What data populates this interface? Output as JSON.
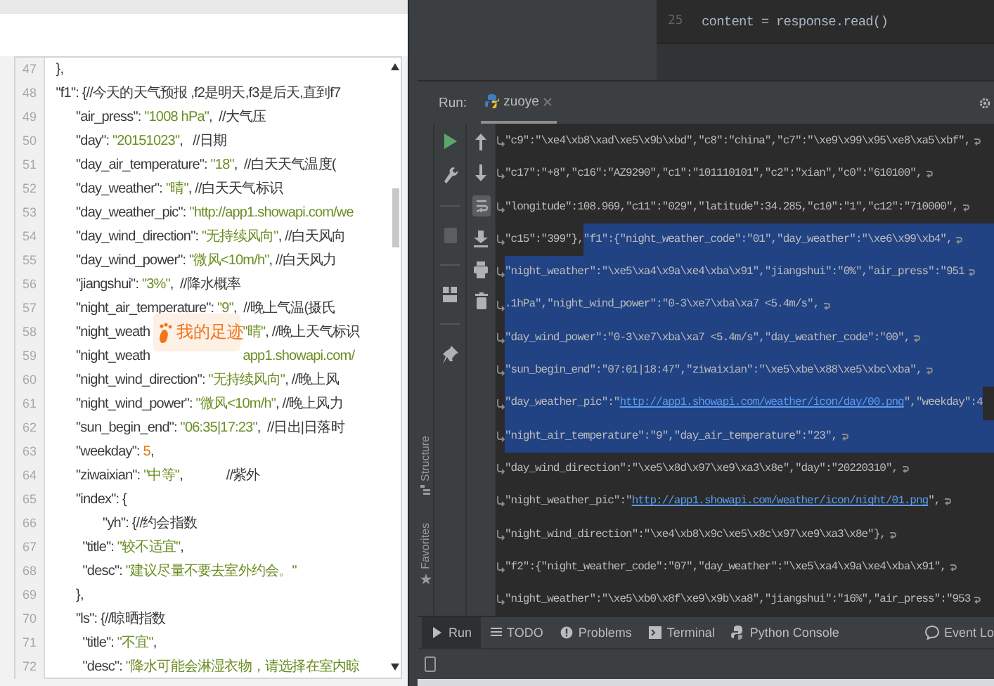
{
  "code_view": {
    "overlay_badge": {
      "label": "我的足迹"
    },
    "lines": [
      {
        "number": "47",
        "segments": [
          {
            "kind": "code",
            "t": "  },"
          }
        ]
      },
      {
        "number": "48",
        "segments": [
          {
            "kind": "code",
            "t": "  \"f1\": {//今天的天气预报 ,f2是明天,f3是后天,直到f7"
          }
        ]
      },
      {
        "number": "49",
        "segments": [
          {
            "kind": "code",
            "t": "        \"air_press\": "
          },
          {
            "kind": "str",
            "t": "\"1008 hPa\""
          },
          {
            "kind": "code",
            "t": ",  //大气压"
          }
        ]
      },
      {
        "number": "50",
        "segments": [
          {
            "kind": "code",
            "t": "        \"day\": "
          },
          {
            "kind": "str",
            "t": "\"20151023\""
          },
          {
            "kind": "code",
            "t": ",   //日期"
          }
        ]
      },
      {
        "number": "51",
        "segments": [
          {
            "kind": "code",
            "t": "        \"day_air_temperature\": "
          },
          {
            "kind": "str",
            "t": "\"18\""
          },
          {
            "kind": "code",
            "t": ",  //白天天气温度("
          }
        ]
      },
      {
        "number": "52",
        "segments": [
          {
            "kind": "code",
            "t": "        \"day_weather\": "
          },
          {
            "kind": "str",
            "t": "\"晴\""
          },
          {
            "kind": "code",
            "t": ", //白天天气标识"
          }
        ]
      },
      {
        "number": "53",
        "segments": [
          {
            "kind": "code",
            "t": "        \"day_weather_pic\": "
          },
          {
            "kind": "str",
            "t": "\"http://app1.showapi.com/we"
          }
        ]
      },
      {
        "number": "54",
        "segments": [
          {
            "kind": "code",
            "t": "        \"day_wind_direction\": "
          },
          {
            "kind": "str",
            "t": "\"无持续风向\""
          },
          {
            "kind": "code",
            "t": ", //白天风向"
          }
        ]
      },
      {
        "number": "55",
        "segments": [
          {
            "kind": "code",
            "t": "        \"day_wind_power\": "
          },
          {
            "kind": "str",
            "t": "\"微风<10m/h\""
          },
          {
            "kind": "code",
            "t": ", //白天风力"
          }
        ]
      },
      {
        "number": "56",
        "segments": [
          {
            "kind": "code",
            "t": "        \"jiangshui\": "
          },
          {
            "kind": "str",
            "t": "\"3%\""
          },
          {
            "kind": "code",
            "t": ",  //降水概率"
          }
        ]
      },
      {
        "number": "57",
        "segments": [
          {
            "kind": "code",
            "t": "        \"night_air_temperature\": "
          },
          {
            "kind": "str",
            "t": "\"9\""
          },
          {
            "kind": "code",
            "t": ",  //晚上气温(摄氏"
          }
        ]
      },
      {
        "number": "58",
        "segments": [
          {
            "kind": "code",
            "t": "        \"night_weath"
          },
          {
            "kind": "str",
            "t": "\"晴\"",
            "covered_before": true
          },
          {
            "kind": "code",
            "t": ", //晚上天气标识"
          }
        ]
      },
      {
        "number": "59",
        "segments": [
          {
            "kind": "code",
            "t": "        \"night_weath"
          },
          {
            "kind": "str",
            "t": "app1.showapi.com/",
            "covered_before": true
          }
        ]
      },
      {
        "number": "60",
        "segments": [
          {
            "kind": "code",
            "t": "        \"night_wind_direction\": "
          },
          {
            "kind": "str",
            "t": "\"无持续风向\""
          },
          {
            "kind": "code",
            "t": ", //晚上风"
          }
        ]
      },
      {
        "number": "61",
        "segments": [
          {
            "kind": "code",
            "t": "        \"night_wind_power\": "
          },
          {
            "kind": "str",
            "t": "\"微风<10m/h\""
          },
          {
            "kind": "code",
            "t": ", //晚上风力"
          }
        ]
      },
      {
        "number": "62",
        "segments": [
          {
            "kind": "code",
            "t": "        \"sun_begin_end\": "
          },
          {
            "kind": "str",
            "t": "\"06:35|17:23\""
          },
          {
            "kind": "code",
            "t": ",  //日出|日落时"
          }
        ]
      },
      {
        "number": "63",
        "segments": [
          {
            "kind": "code",
            "t": "        \"weekday\": "
          },
          {
            "kind": "num",
            "t": "5"
          },
          {
            "kind": "code",
            "t": ","
          }
        ]
      },
      {
        "number": "64",
        "segments": [
          {
            "kind": "code",
            "t": "        \"ziwaixian\": "
          },
          {
            "kind": "str",
            "t": "\"中等\""
          },
          {
            "kind": "code",
            "t": ",             //紫外"
          }
        ]
      },
      {
        "number": "65",
        "segments": [
          {
            "kind": "code",
            "t": "        \"index\": {"
          }
        ]
      },
      {
        "number": "66",
        "segments": [
          {
            "kind": "code",
            "t": "                \"yh\": {//约会指数"
          }
        ]
      },
      {
        "number": "67",
        "segments": [
          {
            "kind": "code",
            "t": "          \"title\": "
          },
          {
            "kind": "str",
            "t": "\"较不适宜\""
          },
          {
            "kind": "code",
            "t": ","
          }
        ]
      },
      {
        "number": "68",
        "segments": [
          {
            "kind": "code",
            "t": "          \"desc\": "
          },
          {
            "kind": "str",
            "t": "\"建议尽量不要去室外约会。\""
          }
        ]
      },
      {
        "number": "69",
        "segments": [
          {
            "kind": "code",
            "t": "        },"
          }
        ]
      },
      {
        "number": "70",
        "segments": [
          {
            "kind": "code",
            "t": "        \"ls\": {//晾晒指数"
          }
        ]
      },
      {
        "number": "71",
        "segments": [
          {
            "kind": "code",
            "t": "          \"title\": "
          },
          {
            "kind": "str",
            "t": "\"不宜\""
          },
          {
            "kind": "code",
            "t": ","
          }
        ]
      },
      {
        "number": "72",
        "segments": [
          {
            "kind": "code",
            "t": "          \"desc\": "
          },
          {
            "kind": "str",
            "t": "\"降水可能会淋湿衣物，请选择在室内晾"
          }
        ]
      }
    ]
  },
  "editor": {
    "lines": [
      {
        "number": "25",
        "text": "content = response.read()"
      }
    ]
  },
  "run_window": {
    "title": "Run:",
    "tabs": [
      {
        "label": "zuoye",
        "selected": true
      }
    ],
    "soft_wrap_on": true,
    "side_tabs": [
      {
        "label": "Structure"
      },
      {
        "label": "Favorites"
      }
    ],
    "output_lines": [
      {
        "wrap_end": true,
        "segments": [
          {
            "t": "\"c9\":\"\\xe4\\xb8\\xad\\xe5\\x9b\\xbd\",\"c8\":\"china\",\"c7\":\"\\xe9\\x99\\x95\\xe8\\xa5\\xbf\",",
            "selected": false,
            "kind": "text"
          }
        ]
      },
      {
        "wrap_end": true,
        "segments": [
          {
            "t": "\"c17\":\"+8\",\"c16\":\"AZ9290\",\"c1\":\"101110101\",\"c2\":\"xian\",\"c0\":\"610100\",",
            "selected": false,
            "kind": "text"
          }
        ]
      },
      {
        "wrap_end": true,
        "segments": [
          {
            "t": "\"longitude\":108.969,\"c11\":\"029\",\"latitude\":34.285,\"c10\":\"1\",\"c12\":\"710000\",",
            "selected": false,
            "kind": "text"
          }
        ]
      },
      {
        "wrap_end": true,
        "segments": [
          {
            "t": "\"c15\":\"399\"},",
            "selected": false,
            "kind": "text"
          },
          {
            "t": "\"f1\":{\"night_weather_code\":\"01\",\"day_weather\":\"\\xe6\\x99\\xb4\",",
            "selected": true,
            "kind": "text"
          }
        ]
      },
      {
        "wrap_end": true,
        "segments": [
          {
            "t": "\"night_weather\":\"\\xe5\\xa4\\x9a\\xe4\\xba\\x91\",\"jiangshui\":\"0%\",\"air_press\":\"951",
            "selected": true,
            "kind": "text"
          }
        ]
      },
      {
        "wrap_end": true,
        "segments": [
          {
            "t": ".1hPa\",\"night_wind_power\":\"0-3\\xe7\\xba\\xa7 <5.4m/s\",",
            "selected": true,
            "kind": "text"
          }
        ]
      },
      {
        "wrap_end": true,
        "segments": [
          {
            "t": "\"day_wind_power\":\"0-3\\xe7\\xba\\xa7 <5.4m/s\",\"day_weather_code\":\"00\",",
            "selected": true,
            "kind": "text"
          }
        ]
      },
      {
        "wrap_end": true,
        "segments": [
          {
            "t": "\"sun_begin_end\":\"07:01|18:47\",\"ziwaixian\":\"\\xe5\\xbe\\x88\\xe5\\xbc\\xba\",",
            "selected": true,
            "kind": "text"
          }
        ]
      },
      {
        "wrap_end": false,
        "segments": [
          {
            "t": "\"day_weather_pic\":\"",
            "selected": true,
            "kind": "text"
          },
          {
            "t": "http://app1.showapi.com/weather/icon/day/00.png",
            "selected": true,
            "kind": "link"
          },
          {
            "t": "\",\"weekday\":4",
            "selected": true,
            "kind": "text"
          }
        ]
      },
      {
        "wrap_end": true,
        "segments": [
          {
            "t": "\"night_air_temperature\":\"9\",\"day_air_temperature\":\"23\",",
            "selected": true,
            "kind": "text"
          }
        ]
      },
      {
        "wrap_end": true,
        "segments": [
          {
            "t": "\"day_wind_direction\":\"\\xe5\\x8d\\x97\\xe9\\xa3\\x8e\",\"day\":\"20220310\",",
            "selected": false,
            "kind": "text"
          }
        ]
      },
      {
        "wrap_end": true,
        "segments": [
          {
            "t": "\"night_weather_pic\":\"",
            "selected": false,
            "kind": "text"
          },
          {
            "t": "http://app1.showapi.com/weather/icon/night/01.png",
            "selected": false,
            "kind": "link"
          },
          {
            "t": "\",",
            "selected": false,
            "kind": "text"
          }
        ]
      },
      {
        "wrap_end": true,
        "segments": [
          {
            "t": "\"night_wind_direction\":\"\\xe4\\xb8\\x9c\\xe5\\x8c\\x97\\xe9\\xa3\\x8e\"},",
            "selected": false,
            "kind": "text"
          }
        ]
      },
      {
        "wrap_end": true,
        "segments": [
          {
            "t": "\"f2\":{\"night_weather_code\":\"07\",\"day_weather\":\"\\xe5\\xa4\\x9a\\xe4\\xba\\x91\",",
            "selected": false,
            "kind": "text"
          }
        ]
      },
      {
        "wrap_end": true,
        "segments": [
          {
            "t": "\"night_weather\":\"\\xe5\\xb0\\x8f\\xe9\\x9b\\xa8\",\"jiangshui\":\"16%\",\"air_press\":\"953",
            "selected": false,
            "kind": "text"
          }
        ]
      }
    ]
  },
  "bottom_tabs": [
    {
      "label": "Run",
      "selected": true
    },
    {
      "label": "TODO",
      "selected": false
    },
    {
      "label": "Problems",
      "selected": false
    },
    {
      "label": "Terminal",
      "selected": false
    },
    {
      "label": "Python Console",
      "selected": false
    },
    {
      "label": "Event Lo",
      "selected": false
    }
  ]
}
